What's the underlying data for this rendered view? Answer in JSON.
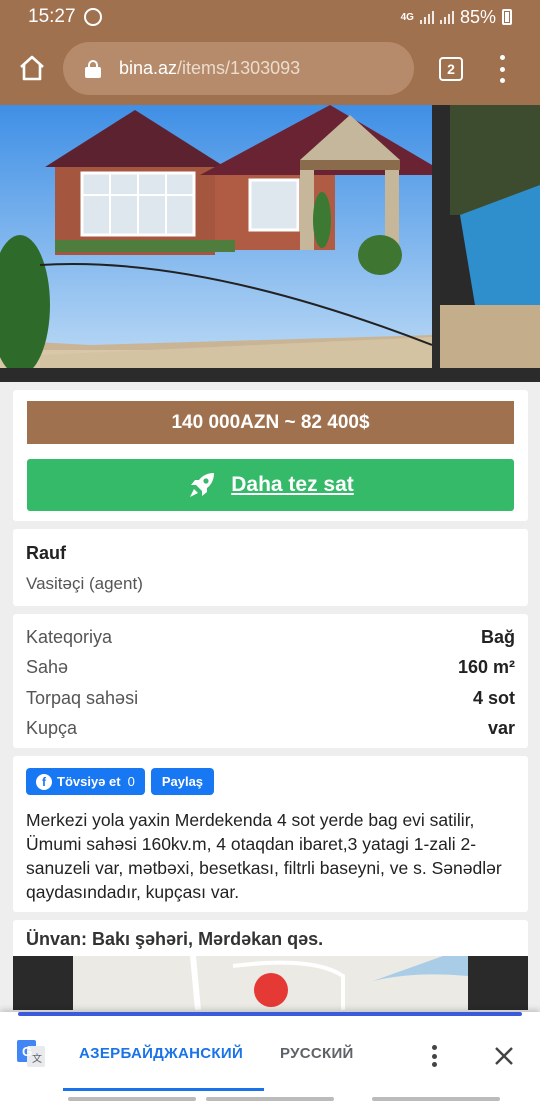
{
  "status_bar": {
    "time": "15:27",
    "network": "4G",
    "battery": "85%"
  },
  "browser": {
    "url_host": "bina.az",
    "url_path": "/items/1303093",
    "tab_count": "2"
  },
  "listing": {
    "price": "140 000AZN ~ 82 400$",
    "sell_button_label": "Daha tez sat",
    "owner_name": "Rauf",
    "owner_role": "Vasitəçi (agent)",
    "properties": [
      {
        "key": "Kateqoriya",
        "value": "Bağ"
      },
      {
        "key": "Sahə",
        "value": "160 m²"
      },
      {
        "key": "Torpaq sahəsi",
        "value": "4 sot"
      },
      {
        "key": "Kupça",
        "value": "var"
      }
    ],
    "social": {
      "recommend_label": "Tövsiyə et",
      "recommend_count": "0",
      "share_label": "Paylaş"
    },
    "description": "Merkezi yola yaxin Merdekenda 4 sot yerde bag evi satilir, Ümumi sahəsi 160kv.m, 4 otaqdan ibaret,3 yatagi 1-zali 2-sanuzeli var, mətbəxi, besetkası, filtrli baseyni, ve s. Sənədlər qaydasındadır, kupçası var.",
    "address": "Ünvan: Bakı şəhəri, Mərdəkan qəs."
  },
  "translate": {
    "lang_active": "АЗЕРБАЙДЖАНСКИЙ",
    "lang_other": "РУССКИЙ"
  },
  "colors": {
    "brand_brown": "#a0714e",
    "sell_green": "#35ba6a",
    "facebook_blue": "#1877f2",
    "translate_blue": "#1a73e8"
  }
}
